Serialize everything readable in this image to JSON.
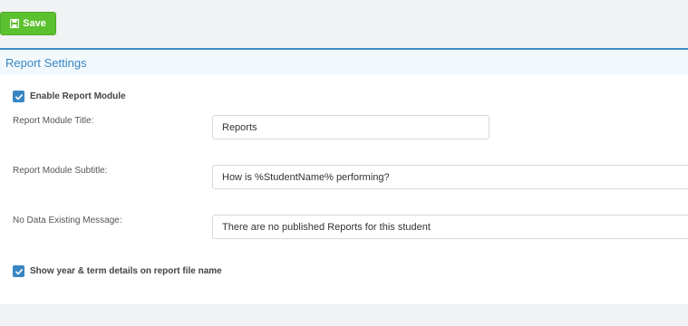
{
  "toolbar": {
    "save_label": "Save",
    "save_icon": "floppy-disk-icon",
    "accent_color": "#5cc12f"
  },
  "panel": {
    "title": "Report Settings",
    "accent_color": "#3a8fc9"
  },
  "settings": {
    "enable_module": {
      "label": "Enable Report Module",
      "checked": true
    },
    "module_title": {
      "label": "Report Module Title:",
      "value": "Reports"
    },
    "module_subtitle": {
      "label": "Report Module Subtitle:",
      "value": "How is %StudentName% performing?"
    },
    "no_data_message": {
      "label": "No Data Existing Message:",
      "value": "There are no published Reports for this student"
    },
    "show_term_details": {
      "label": "Show year & term details on report file name",
      "checked": true
    }
  }
}
